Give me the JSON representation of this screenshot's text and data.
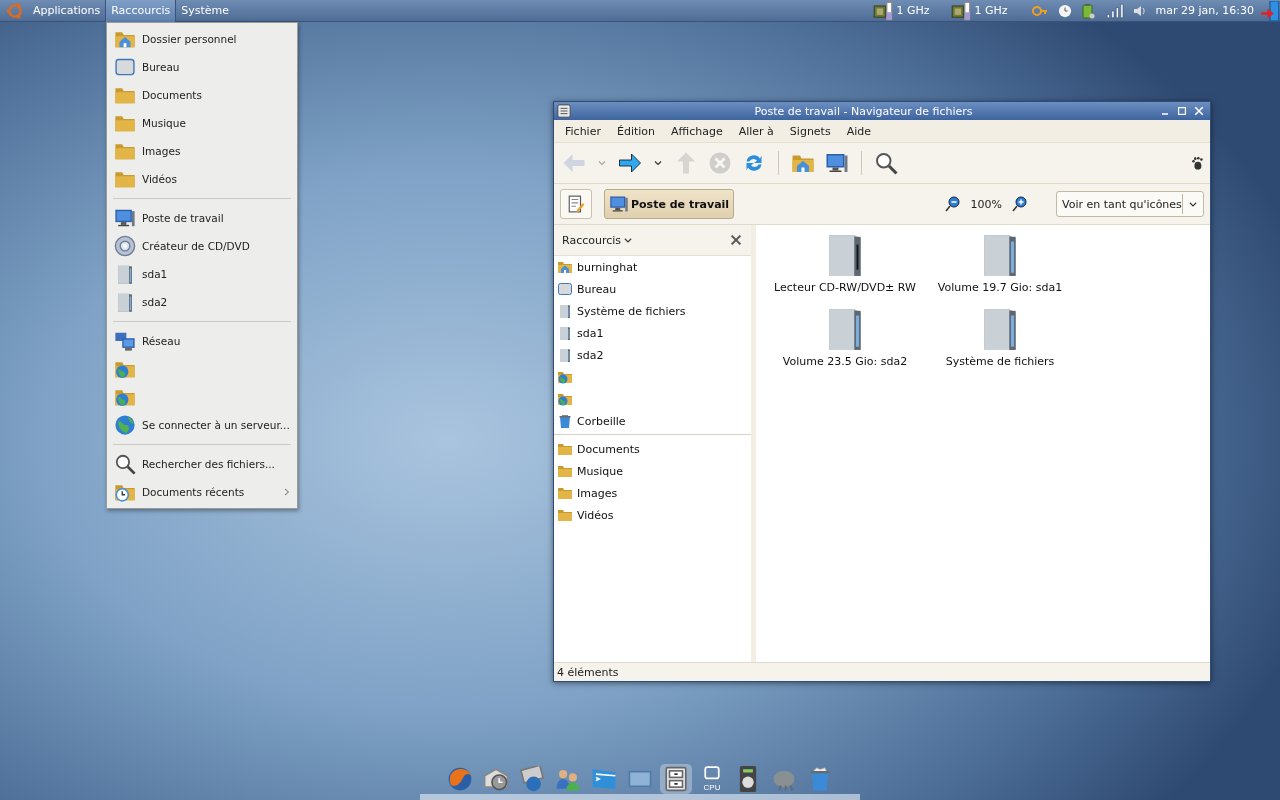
{
  "top_panel": {
    "menus": [
      {
        "label": "Applications",
        "selected": false
      },
      {
        "label": "Raccourcis",
        "selected": true
      },
      {
        "label": "Système",
        "selected": false
      }
    ],
    "cpu_monitors": [
      {
        "reading": "1 GHz"
      },
      {
        "reading": "1 GHz"
      }
    ],
    "clock": "mar 29 jan, 16:30"
  },
  "places_menu": {
    "sections": [
      [
        {
          "kind": "home",
          "label": "Dossier personnel"
        },
        {
          "kind": "desktop",
          "label": "Bureau"
        },
        {
          "kind": "folder",
          "label": "Documents"
        },
        {
          "kind": "folder",
          "label": "Musique"
        },
        {
          "kind": "folder",
          "label": "Images"
        },
        {
          "kind": "folder",
          "label": "Vidéos"
        }
      ],
      [
        {
          "kind": "computer",
          "label": "Poste de travail"
        },
        {
          "kind": "disc",
          "label": "Créateur de CD/DVD"
        },
        {
          "kind": "drive",
          "label": "sda1"
        },
        {
          "kind": "drive",
          "label": "sda2"
        }
      ],
      [
        {
          "kind": "network",
          "label": "Réseau"
        },
        {
          "kind": "globe-folder"
        },
        {
          "kind": "globe-folder"
        },
        {
          "kind": "globe",
          "label": "Se connecter à un serveur..."
        }
      ],
      [
        {
          "kind": "search",
          "label": "Rechercher des fichiers..."
        },
        {
          "kind": "recent",
          "label": "Documents récents",
          "submenu": true
        }
      ]
    ]
  },
  "window": {
    "title": "Poste de travail - Navigateur de fichiers",
    "menu": [
      "Fichier",
      "Édition",
      "Affichage",
      "Aller à",
      "Signets",
      "Aide"
    ],
    "toolbar": [
      {
        "kind": "back",
        "disabled": true
      },
      {
        "kind": "dropdown",
        "disabled": true
      },
      {
        "kind": "forward",
        "disabled": false
      },
      {
        "kind": "dropdown",
        "disabled": false
      },
      {
        "kind": "up",
        "disabled": true
      },
      {
        "kind": "stop",
        "disabled": true
      },
      {
        "kind": "reload",
        "disabled": false
      },
      {
        "kind": "separator"
      },
      {
        "kind": "home",
        "disabled": false
      },
      {
        "kind": "computer",
        "disabled": false
      },
      {
        "kind": "separator"
      },
      {
        "kind": "search",
        "disabled": false
      }
    ],
    "location_button": "Poste de travail",
    "zoom": "100%",
    "view_mode": "Voir en tant qu'icônes",
    "sidebar": {
      "title": "Raccourcis",
      "sections": [
        [
          {
            "kind": "home",
            "label": "burninghat"
          },
          {
            "kind": "desktop",
            "label": "Bureau"
          },
          {
            "kind": "drive",
            "label": "Système de fichiers"
          },
          {
            "kind": "drive",
            "label": "sda1"
          },
          {
            "kind": "drive",
            "label": "sda2"
          },
          {
            "kind": "globe-folder"
          },
          {
            "kind": "globe-folder"
          },
          {
            "kind": "trash",
            "label": "Corbeille"
          }
        ],
        [
          {
            "kind": "folder",
            "label": "Documents"
          },
          {
            "kind": "folder",
            "label": "Musique"
          },
          {
            "kind": "folder",
            "label": "Images"
          },
          {
            "kind": "folder",
            "label": "Vidéos"
          }
        ]
      ]
    },
    "items": [
      {
        "kind": "optical",
        "label": "Lecteur CD-RW/DVD± RW"
      },
      {
        "kind": "drive",
        "label": "Volume 19.7 Gio: sda1"
      },
      {
        "kind": "drive",
        "label": "Volume 23.5 Gio: sda2"
      },
      {
        "kind": "drive",
        "label": "Système de fichiers"
      }
    ],
    "status": "4 éléments"
  },
  "dock": {
    "items": [
      {
        "kind": "browser",
        "selected": false
      },
      {
        "kind": "mail",
        "selected": false
      },
      {
        "kind": "network",
        "selected": false
      },
      {
        "kind": "users",
        "selected": false
      },
      {
        "kind": "terminal",
        "selected": false
      },
      {
        "kind": "screen",
        "selected": false
      },
      {
        "kind": "cabinet",
        "selected": true
      },
      {
        "kind": "cpu",
        "text": "CPU",
        "selected": false
      },
      {
        "kind": "speaker",
        "selected": false
      },
      {
        "kind": "weather",
        "selected": false
      },
      {
        "kind": "trash",
        "selected": false
      }
    ]
  }
}
